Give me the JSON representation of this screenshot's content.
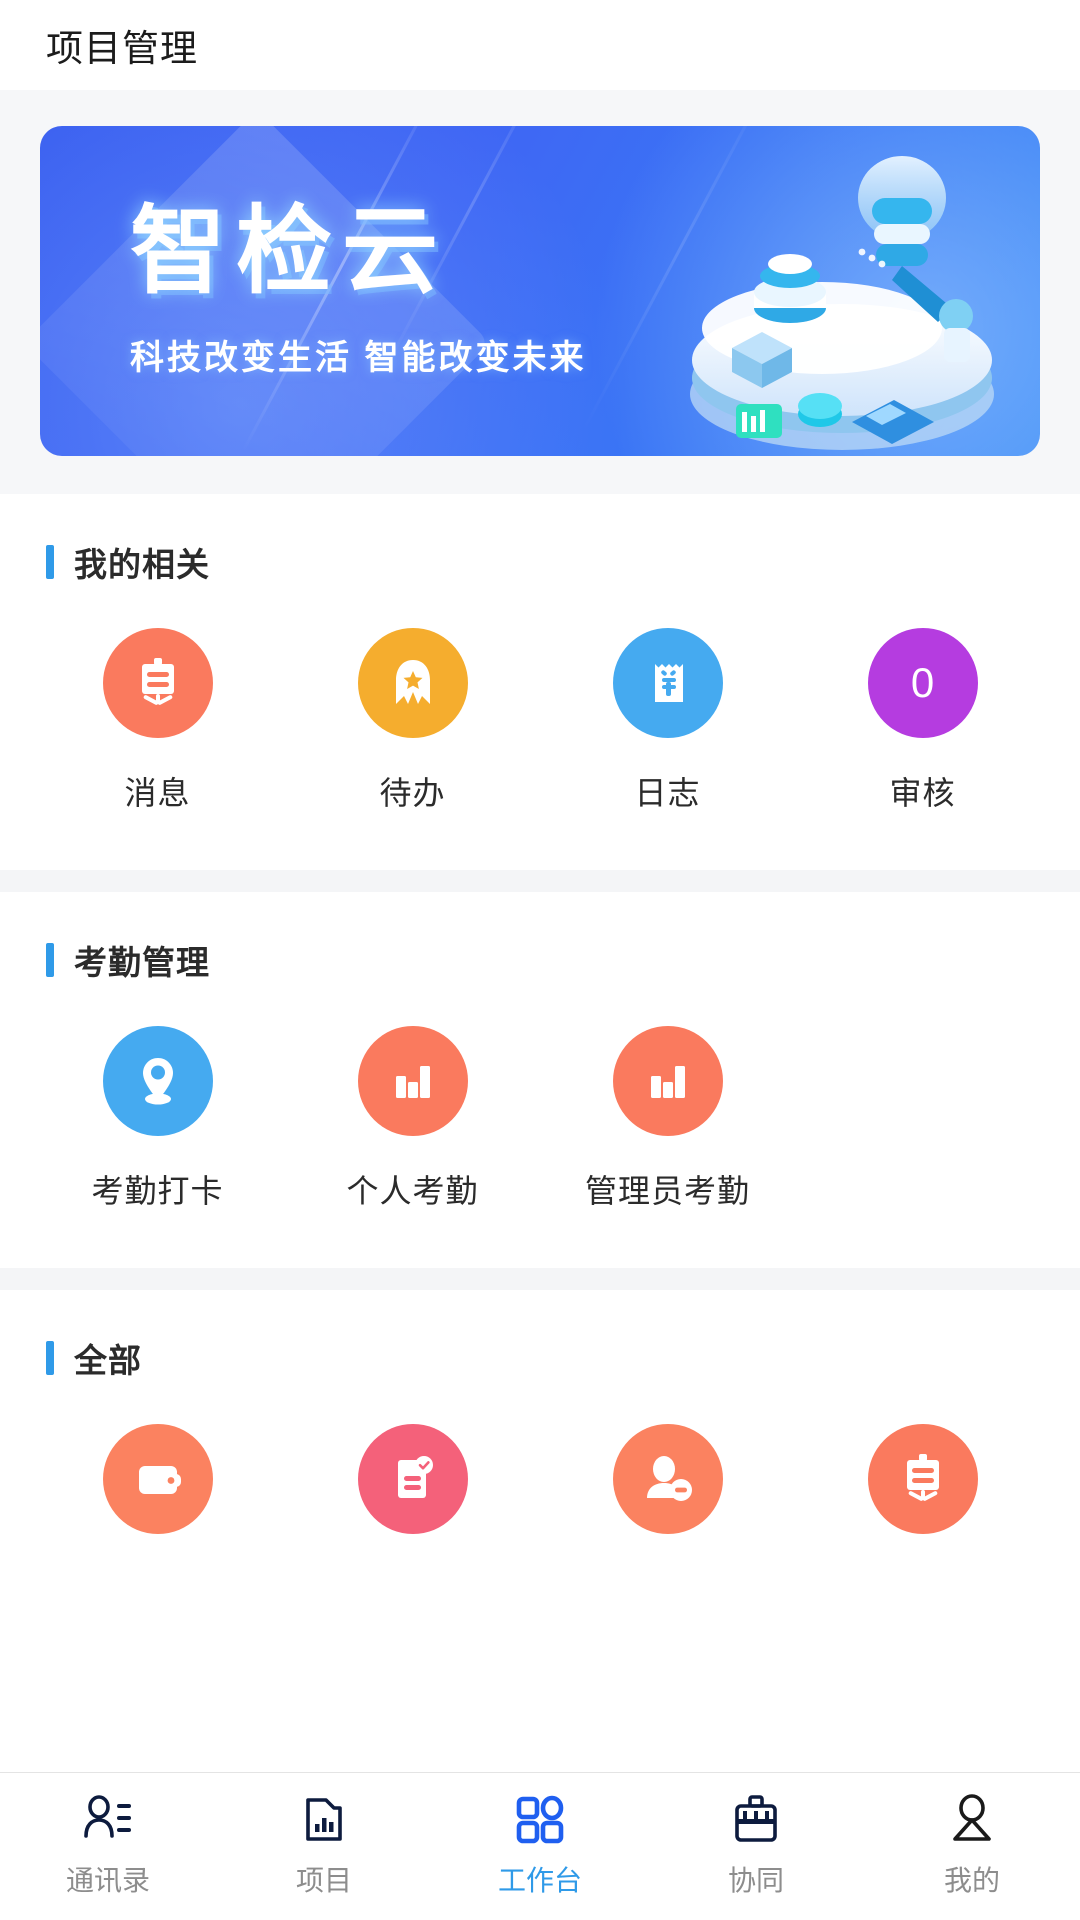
{
  "header": {
    "title": "项目管理"
  },
  "banner": {
    "title": "智检云",
    "subtitle": "科技改变生活  智能改变未来",
    "bg_color": "#3a5ff0",
    "illustration": "isometric-robot-cloud-illustration"
  },
  "sections": [
    {
      "title": "我的相关",
      "accent_color": "#2f9ae8",
      "items": [
        {
          "label": "消息",
          "icon": "announcement-board-icon",
          "color": "#fa7a5e",
          "badge": ""
        },
        {
          "label": "待办",
          "icon": "award-ribbon-icon",
          "color": "#f5ad2e",
          "badge": ""
        },
        {
          "label": "日志",
          "icon": "receipt-yuan-icon",
          "color": "#45aaf0",
          "badge": ""
        },
        {
          "label": "审核",
          "icon": "count-badge-icon",
          "color": "#b53ce0",
          "badge": "0"
        }
      ]
    },
    {
      "title": "考勤管理",
      "accent_color": "#2f9ae8",
      "items": [
        {
          "label": "考勤打卡",
          "icon": "location-pin-icon",
          "color": "#45aaf0",
          "badge": ""
        },
        {
          "label": "个人考勤",
          "icon": "bar-chart-icon",
          "color": "#fa7a5e",
          "badge": ""
        },
        {
          "label": "管理员考勤",
          "icon": "bar-chart-icon",
          "color": "#fa7a5e",
          "badge": ""
        }
      ]
    },
    {
      "title": "全部",
      "accent_color": "#2f9ae8",
      "items": [
        {
          "label": "",
          "icon": "wallet-icon",
          "color": "#fb8260",
          "badge": ""
        },
        {
          "label": "",
          "icon": "document-check-icon",
          "color": "#f4617a",
          "badge": ""
        },
        {
          "label": "",
          "icon": "person-remove-icon",
          "color": "#fb8260",
          "badge": ""
        },
        {
          "label": "",
          "icon": "announcement-board-icon",
          "color": "#fa7a5e",
          "badge": ""
        }
      ]
    }
  ],
  "tabbar": {
    "active_color": "#2f9ae8",
    "inactive_color": "#8d8d8d",
    "tabs": [
      {
        "label": "通讯录",
        "icon": "contacts-icon",
        "active": false
      },
      {
        "label": "项目",
        "icon": "folder-chart-icon",
        "active": false
      },
      {
        "label": "工作台",
        "icon": "grid-apps-icon",
        "active": true
      },
      {
        "label": "协同",
        "icon": "briefcase-icon",
        "active": false
      },
      {
        "label": "我的",
        "icon": "person-icon",
        "active": false
      }
    ]
  }
}
